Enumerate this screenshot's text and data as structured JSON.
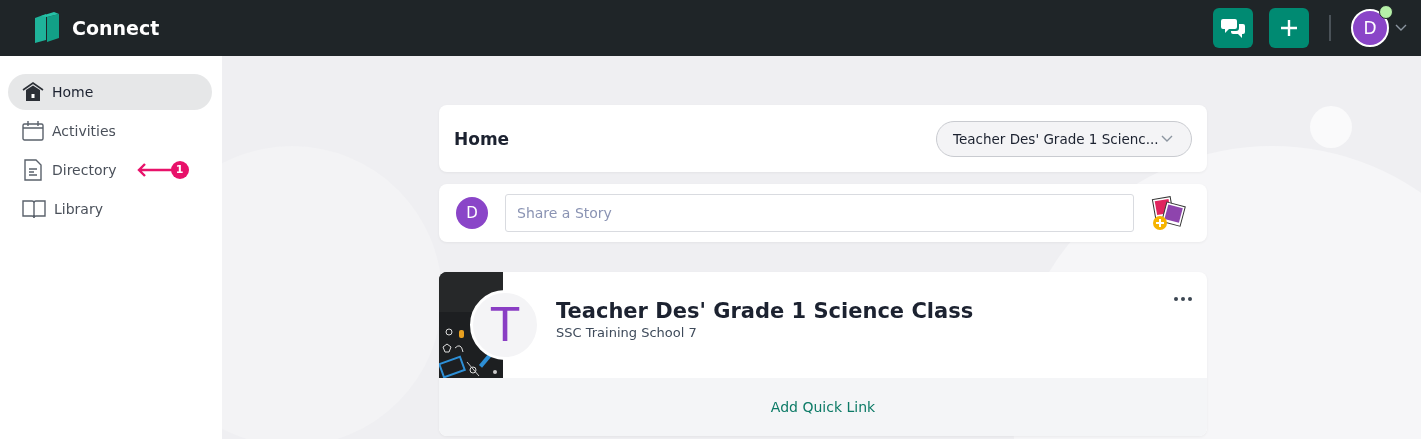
{
  "app": {
    "name": "Connect"
  },
  "header": {
    "user_initial": "D",
    "online": true
  },
  "sidebar": {
    "items": [
      {
        "label": "Home",
        "kind": "home",
        "selected": true
      },
      {
        "label": "Activities",
        "kind": "calendar",
        "selected": false
      },
      {
        "label": "Directory",
        "kind": "document",
        "selected": false,
        "callout": "1"
      },
      {
        "label": "Library",
        "kind": "book",
        "selected": false
      }
    ]
  },
  "page": {
    "title": "Home",
    "class_select": "Teacher Des' Grade 1 Scienc..."
  },
  "composer": {
    "user_initial": "D",
    "placeholder": "Share a Story"
  },
  "class_card": {
    "avatar_letter": "T",
    "name": "Teacher Des' Grade 1 Science Class",
    "school": "SSC Training School 7",
    "quick_link": "Add Quick Link"
  }
}
